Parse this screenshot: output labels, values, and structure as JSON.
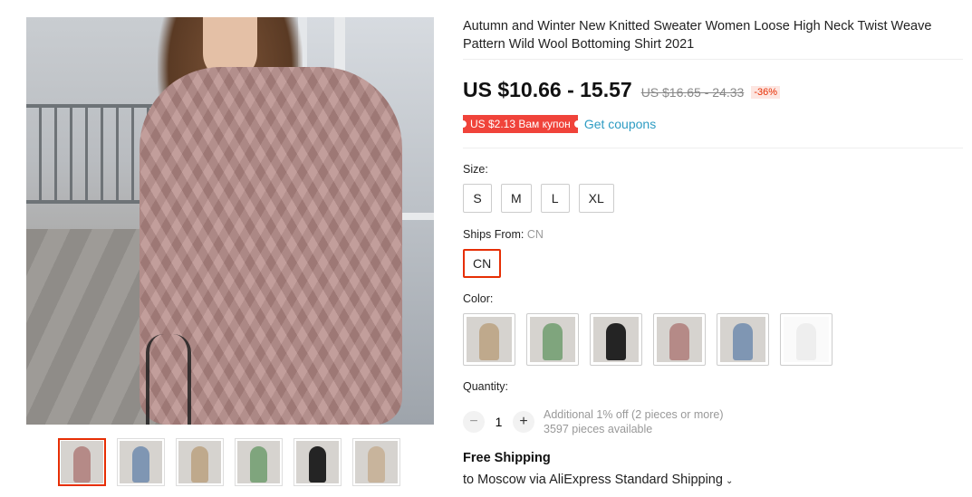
{
  "product": {
    "title": "Autumn and Winter New Knitted Sweater Women Loose High Neck Twist Weave Pattern Wild Wool Bottoming Shirt 2021"
  },
  "gallery": {
    "main_image_alt": "pink-cable-knit-sweater-dress",
    "thumbnails": [
      {
        "name": "pink",
        "color": "#b58a87",
        "active": true
      },
      {
        "name": "blue",
        "color": "#7f96b3",
        "active": false
      },
      {
        "name": "beige",
        "color": "#bfa98c",
        "active": false
      },
      {
        "name": "green",
        "color": "#7fa57d",
        "active": false
      },
      {
        "name": "black",
        "color": "#242424",
        "active": false
      },
      {
        "name": "flat-lay",
        "color": "#c8b49c",
        "active": false
      }
    ]
  },
  "pricing": {
    "price": "US $10.66 - 15.57",
    "old_price": "US $16.65 - 24.33",
    "discount": "-36%"
  },
  "coupon": {
    "badge": "US $2.13 Вам купон",
    "link": "Get coupons"
  },
  "size": {
    "label": "Size:",
    "options": [
      "S",
      "M",
      "L",
      "XL"
    ]
  },
  "ships_from": {
    "label": "Ships From:",
    "value": "CN",
    "options": [
      "CN"
    ]
  },
  "color": {
    "label": "Color:",
    "swatches": [
      {
        "name": "beige",
        "color": "#bfa98c"
      },
      {
        "name": "green",
        "color": "#7fa57d"
      },
      {
        "name": "black",
        "color": "#242424"
      },
      {
        "name": "pink",
        "color": "#b58a87"
      },
      {
        "name": "blue",
        "color": "#7f96b3"
      },
      {
        "name": "white",
        "color": "#eeeeee"
      }
    ]
  },
  "quantity": {
    "label": "Quantity:",
    "value": "1",
    "minus": "−",
    "plus": "+",
    "offer": "Additional 1% off (2 pieces or more)",
    "available": "3597 pieces available"
  },
  "shipping": {
    "title": "Free Shipping",
    "line": "to Moscow via AliExpress Standard Shipping"
  },
  "colors": {
    "accent": "#e62e04",
    "link": "#2e9cc3",
    "coupon_bg": "#f0433a"
  }
}
